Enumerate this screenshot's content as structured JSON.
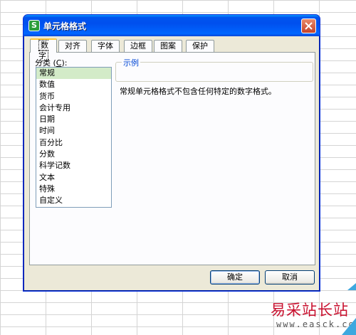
{
  "dialog": {
    "icon_letter": "S",
    "title": "单元格格式",
    "close_icon": "close-x-icon"
  },
  "tabs": [
    {
      "label": "数字",
      "active": true
    },
    {
      "label": "对齐"
    },
    {
      "label": "字体"
    },
    {
      "label": "边框"
    },
    {
      "label": "图案"
    },
    {
      "label": "保护"
    }
  ],
  "category": {
    "label_prefix": "分类 (",
    "label_key": "C",
    "label_suffix": "):",
    "items": [
      "常规",
      "数值",
      "货币",
      "会计专用",
      "日期",
      "时间",
      "百分比",
      "分数",
      "科学记数",
      "文本",
      "特殊",
      "自定义"
    ],
    "selected_index": 0
  },
  "sample": {
    "title": "示例"
  },
  "description": "常规单元格格式不包含任何特定的数字格式。",
  "buttons": {
    "ok": "确定",
    "cancel": "取消"
  },
  "watermark": {
    "text": "易采站长站",
    "url": "www.easck.com"
  },
  "colors": {
    "titlebar": "#0054e3",
    "selection": "#d3ebc8",
    "watermark": "#c8102e"
  }
}
